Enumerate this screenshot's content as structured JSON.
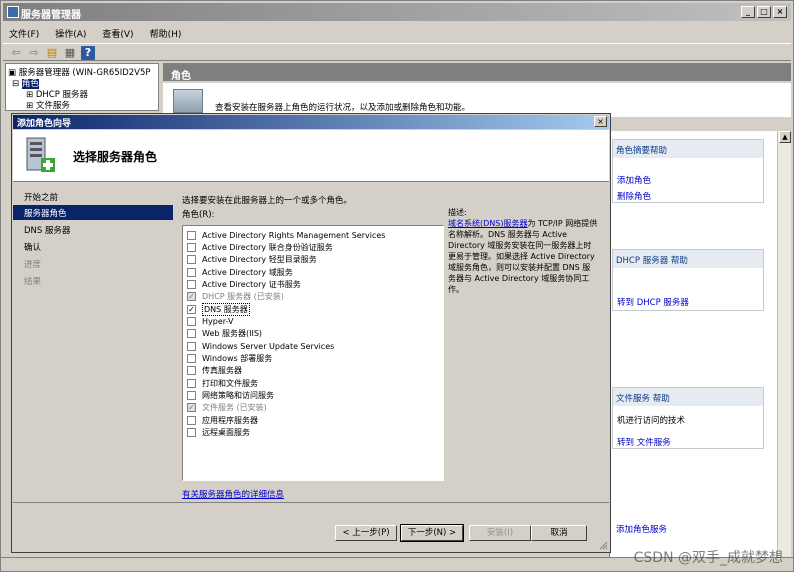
{
  "window": {
    "title": "服务器管理器",
    "minimize": "_",
    "restore": "□",
    "close": "×"
  },
  "menu": [
    "文件(F)",
    "操作(A)",
    "查看(V)",
    "帮助(H)"
  ],
  "tree": {
    "root": "服务器管理器 (WIN-GR65ID2V5P",
    "roles": "角色",
    "dhcp": "DHCP 服务器",
    "file": "文件服务"
  },
  "main": {
    "header": "角色",
    "description": "查看安装在服务器上角色的运行状况，以及添加或删除角色和功能。"
  },
  "side": {
    "summary_title": "角色摘要帮助",
    "add_role": "添加角色",
    "remove_role": "删除角色",
    "dhcp_help": "DHCP 服务器 帮助",
    "goto_dhcp": "转到 DHCP 服务器",
    "file_help": "文件服务 帮助",
    "file_text": "机进行访问的技术",
    "goto_file": "转到 文件服务",
    "add_role_service": "添加角色服务"
  },
  "dialog": {
    "title": "添加角色向导",
    "close": "×",
    "heading": "选择服务器角色",
    "steps": [
      {
        "label": "开始之前",
        "state": "normal"
      },
      {
        "label": "服务器角色",
        "state": "active"
      },
      {
        "label": "DNS 服务器",
        "state": "normal"
      },
      {
        "label": "确认",
        "state": "normal"
      },
      {
        "label": "进度",
        "state": "dis"
      },
      {
        "label": "结果",
        "state": "dis"
      }
    ],
    "instruction": "选择要安装在此服务器上的一个或多个角色。",
    "roles_label": "角色(R):",
    "roles": [
      {
        "label": "Active Directory Rights Management Services",
        "checked": false,
        "disabled": false
      },
      {
        "label": "Active Directory 联合身份验证服务",
        "checked": false,
        "disabled": false
      },
      {
        "label": "Active Directory 轻型目录服务",
        "checked": false,
        "disabled": false
      },
      {
        "label": "Active Directory 域服务",
        "checked": false,
        "disabled": false
      },
      {
        "label": "Active Directory 证书服务",
        "checked": false,
        "disabled": false
      },
      {
        "label": "DHCP 服务器   (已安装)",
        "checked": true,
        "disabled": true
      },
      {
        "label": "DNS 服务器",
        "checked": true,
        "disabled": false,
        "selected": true
      },
      {
        "label": "Hyper-V",
        "checked": false,
        "disabled": false
      },
      {
        "label": "Web 服务器(IIS)",
        "checked": false,
        "disabled": false
      },
      {
        "label": "Windows Server Update Services",
        "checked": false,
        "disabled": false
      },
      {
        "label": "Windows 部署服务",
        "checked": false,
        "disabled": false
      },
      {
        "label": "传真服务器",
        "checked": false,
        "disabled": false
      },
      {
        "label": "打印和文件服务",
        "checked": false,
        "disabled": false
      },
      {
        "label": "网络策略和访问服务",
        "checked": false,
        "disabled": false
      },
      {
        "label": "文件服务   (已安装)",
        "checked": true,
        "disabled": true
      },
      {
        "label": "应用程序服务器",
        "checked": false,
        "disabled": false
      },
      {
        "label": "远程桌面服务",
        "checked": false,
        "disabled": false
      }
    ],
    "desc_label": "描述:",
    "desc_link": "域名系统(DNS)服务器",
    "desc_text": "为 TCP/IP 网络提供名称解析。DNS 服务器与 Active Directory 域服务安装在同一服务器上时更易于管理。如果选择 Active Directory 域服务角色，则可以安装并配置 DNS 服务器与 Active Directory 域服务协同工作。",
    "more_info": "有关服务器角色的详细信息",
    "buttons": {
      "back": "< 上一步(P)",
      "next": "下一步(N) >",
      "install": "安装(I)",
      "cancel": "取消"
    }
  },
  "watermark": "CSDN @双手_成就梦想"
}
